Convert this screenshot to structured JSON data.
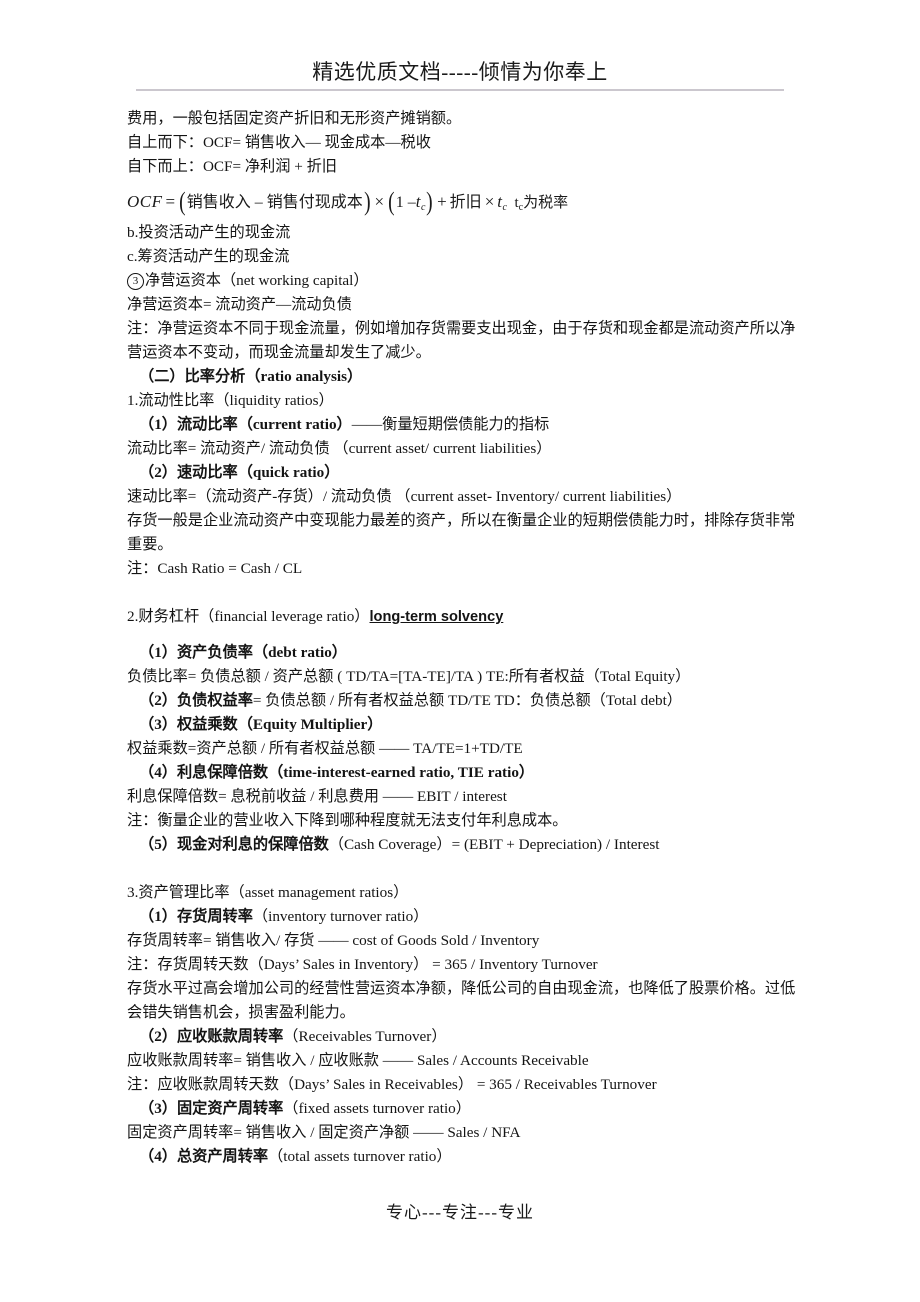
{
  "header": {
    "title": "精选优质文档-----倾情为你奉上"
  },
  "footer": {
    "text": "专心---专注---专业"
  },
  "body": {
    "l01": "费用，一般包括固定资产折旧和无形资产摊销额。",
    "l02": "自上而下：OCF= 销售收入— 现金成本—税收",
    "l03": "自下而上：OCF= 净利润 + 折旧",
    "equation": {
      "lhs": "OCF",
      "eq_sign": "=",
      "group1": "销售收入 – 销售付现成本",
      "times1": "×",
      "group2_a": "1 –",
      "group2_b": "t",
      "group2_sub": "c",
      "plus": "+",
      "term3": "折旧",
      "times2": "×",
      "term3_b": "t",
      "term3_sub": "c",
      "note_var": "t",
      "note_sub": "c",
      "note_text": "为税率"
    },
    "l05": "b.投资活动产生的现金流",
    "l06": "c.筹资活动产生的现金流",
    "l07_num": "3",
    "l07": "净营运资本（net working capital）",
    "l08": "净营运资本= 流动资产—流动负债",
    "l09": "注：净营运资本不同于现金流量，例如增加存货需要支出现金，由于存货和现金都是流动资产所以净营运资本不变动，而现金流量却发生了减少。",
    "l10": "（二）比率分析（ratio analysis）",
    "l11": "1.流动性比率（liquidity ratios）",
    "l12_a": "（1）流动比率（current ratio）",
    "l12_b": "——衡量短期偿债能力的指标",
    "l13": "流动比率= 流动资产/ 流动负债 （current asset/ current liabilities）",
    "l14": "（2）速动比率（quick ratio）",
    "l15": "速动比率=（流动资产-存货）/ 流动负债 （current asset- Inventory/ current liabilities）",
    "l16": "存货一般是企业流动资产中变现能力最差的资产，所以在衡量企业的短期偿债能力时，排除存货非常重要。",
    "l17": "注：Cash Ratio = Cash / CL",
    "l18_a": "2.财务杠杆（financial leverage ratio）",
    "l18_b": "long-term solvency",
    "l19": "（1）资产负债率（debt ratio）",
    "l20": "负债比率= 负债总额 / 资产总额 ( TD/TA=[TA-TE]/TA ) TE:所有者权益（Total Equity）",
    "l21_a": "（2）负债权益率",
    "l21_b": "= 负债总额 / 所有者权益总额 TD/TE  TD：负债总额（Total debt）",
    "l22": "（3）权益乘数（Equity Multiplier）",
    "l23": "权益乘数=资产总额 / 所有者权益总额 —— TA/TE=1+TD/TE",
    "l24": "（4）利息保障倍数（time-interest-earned ratio, TIE ratio）",
    "l25": "利息保障倍数= 息税前收益 / 利息费用 —— EBIT / interest",
    "l26": "注：衡量企业的营业收入下降到哪种程度就无法支付年利息成本。",
    "l27_a": "（5）现金对利息的保障倍数",
    "l27_b": "（Cash Coverage）= (EBIT + Depreciation) / Interest",
    "l28": "3.资产管理比率（asset management ratios）",
    "l29_a": "（1）存货周转率",
    "l29_b": "（inventory turnover ratio）",
    "l30": "存货周转率= 销售收入/ 存货 —— cost of Goods Sold / Inventory",
    "l31": "注：存货周转天数（Days’ Sales in Inventory） = 365 / Inventory Turnover",
    "l32": "存货水平过高会增加公司的经营性营运资本净额，降低公司的自由现金流，也降低了股票价格。过低会错失销售机会，损害盈利能力。",
    "l33_a": "（2）应收账款周转率",
    "l33_b": "（Receivables Turnover）",
    "l34": "应收账款周转率= 销售收入 / 应收账款 —— Sales / Accounts Receivable",
    "l35": "注：应收账款周转天数（Days’ Sales in Receivables） = 365 / Receivables Turnover",
    "l36_a": "（3）固定资产周转率",
    "l36_b": "（fixed assets turnover ratio）",
    "l37": "固定资产周转率= 销售收入 / 固定资产净额 —— Sales / NFA",
    "l38_a": "（4）总资产周转率",
    "l38_b": "（total assets turnover ratio）"
  }
}
